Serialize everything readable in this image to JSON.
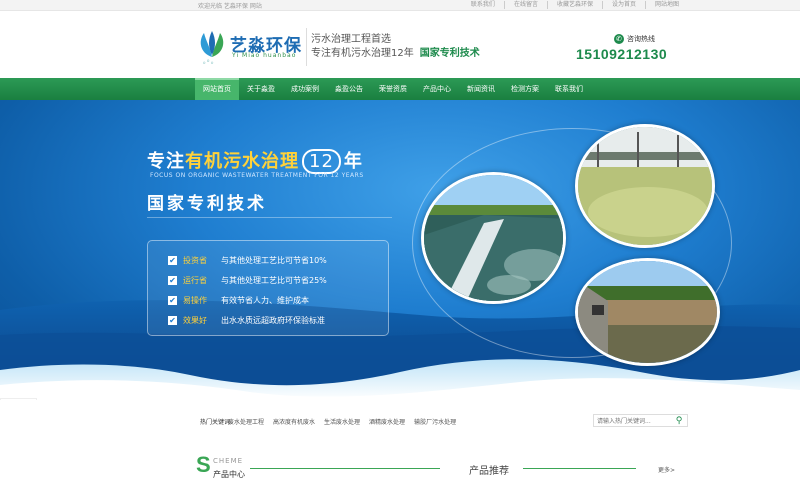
{
  "topbar": {
    "welcome": "欢迎光临 艺淼环保 网站",
    "links": [
      "联系我们",
      "在线留言",
      "收藏艺淼环保",
      "设为首页",
      "网站地图"
    ]
  },
  "header": {
    "logo_name": "艺淼环保",
    "logo_en": "Yi Miao huanbao",
    "slogan_line1": "污水治理工程首选",
    "slogan_line2": "专注有机污水治理12年",
    "slogan_highlight": "国家专利技术",
    "hotline_label": "咨询热线",
    "hotline_number": "15109212130"
  },
  "nav": {
    "items": [
      "网站首页",
      "关于淼盈",
      "成功案例",
      "淼盈公告",
      "荣誉资质",
      "产品中心",
      "新闻资讯",
      "检测方案",
      "联系我们"
    ]
  },
  "banner": {
    "title_pre": "专注",
    "title_highlight": "有机污水治理",
    "title_num": "12",
    "title_post": "年",
    "english": "FOCUS ON ORGANIC WASTEWATER TREATMENT FOR 12 YEARS",
    "subtitle": "国家专利技术",
    "features": [
      {
        "key": "投资省",
        "text": "与其他处理工艺比可节省10%"
      },
      {
        "key": "运行省",
        "text": "与其他处理工艺比可节省25%"
      },
      {
        "key": "易操作",
        "text": "有效节省人力、维护成本"
      },
      {
        "key": "效果好",
        "text": "出水水质远超政府环保验标准"
      }
    ],
    "check_glyph": "✔"
  },
  "keywords": {
    "label": "热门关键词:",
    "tags": [
      "废水处理工程",
      "高浓度有机废水",
      "生活废水处理",
      "酒精废水处理",
      "输胶厂污水处理"
    ],
    "search_placeholder": "请输入热门关键词...",
    "search_icon": "search-icon"
  },
  "products": {
    "letter": "S",
    "scheme": "CHEME",
    "cn": "产品中心",
    "title": "产品推荐",
    "more": "更多>"
  },
  "colors": {
    "brand_green": "#1d8a4c",
    "brand_blue": "#1e6cb3",
    "highlight_yellow": "#ffd23a"
  }
}
